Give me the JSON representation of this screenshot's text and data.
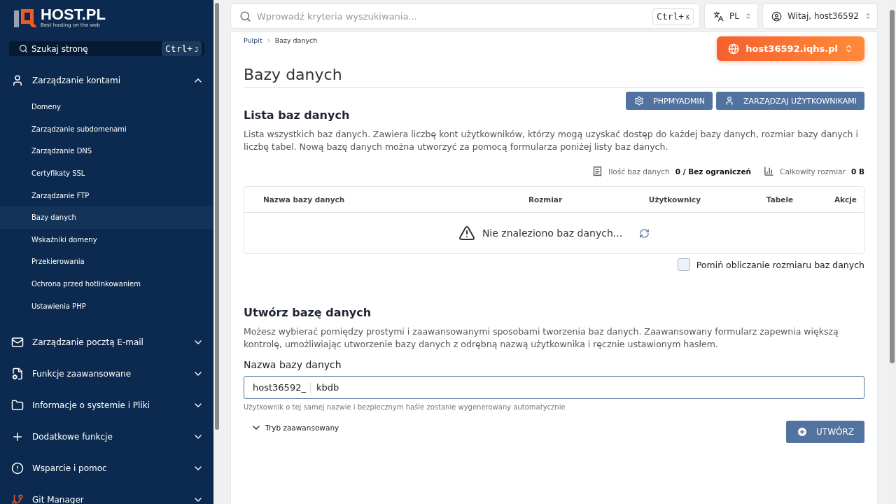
{
  "logo": {
    "name": "HOST.PL",
    "tagline": "Best hosting on the web"
  },
  "sidebar": {
    "search": {
      "placeholder": "Szukaj stronę",
      "shortcut": "Ctrl+",
      "shortcut_key": "J"
    },
    "groups": [
      {
        "label": "Zarządzanie kontami",
        "expanded": true,
        "children": [
          {
            "label": "Domeny",
            "selected": false
          },
          {
            "label": "Zarządzanie subdomenami",
            "selected": false
          },
          {
            "label": "Zarządzanie DNS",
            "selected": false
          },
          {
            "label": "Certyfikaty SSL",
            "selected": false
          },
          {
            "label": "Zarządzanie FTP",
            "selected": false
          },
          {
            "label": "Bazy danych",
            "selected": true
          },
          {
            "label": "Wskaźniki domeny",
            "selected": false
          },
          {
            "label": "Przekierowania",
            "selected": false
          },
          {
            "label": "Ochrona przed hotlinkowaniem",
            "selected": false
          },
          {
            "label": "Ustawienia PHP",
            "selected": false
          }
        ]
      },
      {
        "label": "Zarządzanie pocztą E-mail",
        "expanded": false
      },
      {
        "label": "Funkcje zaawansowane",
        "expanded": false
      },
      {
        "label": "Informacje o systemie i Pliki",
        "expanded": false
      },
      {
        "label": "Dodatkowe funkcje",
        "expanded": false
      },
      {
        "label": "Wsparcie i pomoc",
        "expanded": false
      },
      {
        "label": "Git Manager",
        "expanded": false
      }
    ]
  },
  "topbar": {
    "search": {
      "placeholder": "Wprowadź kryteria wyszukiwania...",
      "shortcut": "Ctrl+",
      "shortcut_key": "K"
    },
    "language": "PL",
    "user": "Witaj, host36592"
  },
  "breadcrumb": [
    "Pulpit",
    "Bazy danych"
  ],
  "domain": "host36592.iqhs.pl",
  "title": "Bazy danych",
  "actions": [
    "PHPMYADMIN",
    "ZARZĄDZAJ UŻYTKOWNIKAMI"
  ],
  "list": {
    "heading": "Lista baz danych",
    "description": "Lista wszystkich baz danych. Zawiera liczbę kont użytkowników, którzy mogą uzyskać dostęp do każdej bazy danych, rozmiar bazy danych i liczbę tabel. Nową bazę danych można utworzyć za pomocą formularza poniżej listy baz danych.",
    "stats": [
      {
        "label": "Ilość baz danych",
        "value": "0 / Bez ograniczeń"
      },
      {
        "label": "Całkowity rozmiar",
        "value": "0 B"
      }
    ],
    "columns": [
      "Nazwa bazy danych",
      "Rozmiar",
      "Użytkownicy",
      "Tabele",
      "Akcje"
    ],
    "empty": "Nie znaleziono baz danych...",
    "skip_size": {
      "label": "Pomiń obliczanie rozmiaru baz danych",
      "checked": false
    }
  },
  "create": {
    "heading": "Utwórz bazę danych",
    "description": "Możesz wybierać pomiędzy prostymi i zaawansowanymi sposobami tworzenia baz danych. Zaawansowany formularz zapewnia większą kontrolę, umożliwiając utworzenie bazy danych z odrębną nazwą użytkownika i ręcznie ustawionym hasłem.",
    "field_label": "Nazwa bazy danych",
    "prefix": "host36592_",
    "value": "kbdb",
    "hint": "Użytkownik o tej samej nazwie i bezpiecznym haśle zostanie wygenerowany automatycznie",
    "advanced": {
      "label": "Tryb zaawansowany",
      "expanded": false
    },
    "submit": "UTWÓRZ"
  }
}
